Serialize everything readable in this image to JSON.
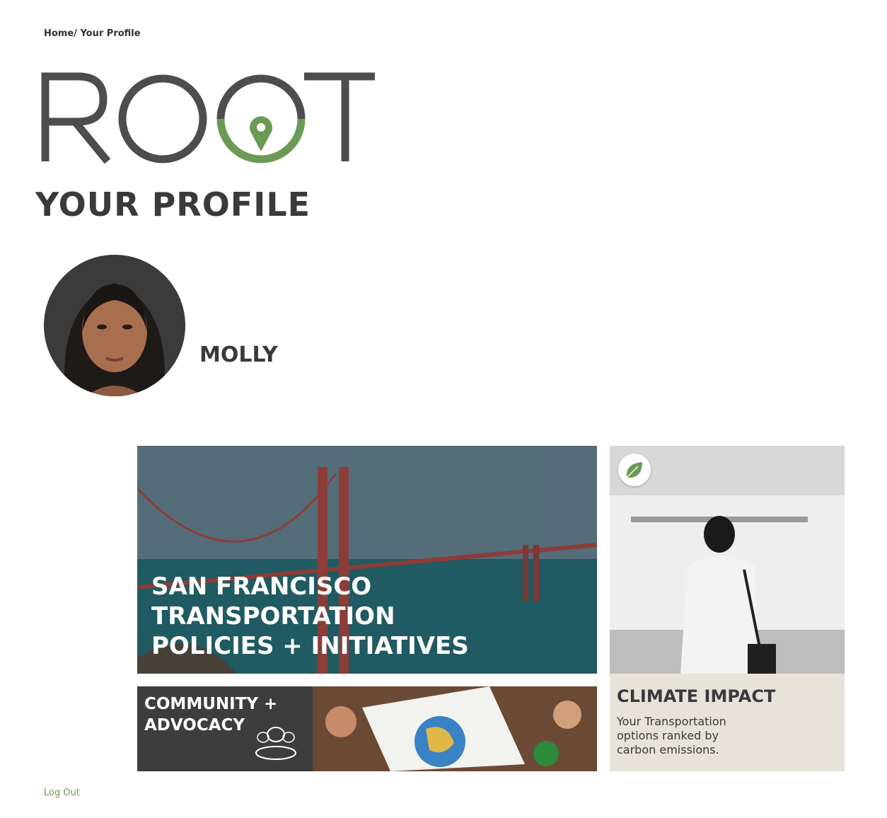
{
  "breadcrumb": {
    "text": "Home/ Your Profile"
  },
  "logo": {
    "text": "ROOT",
    "colors": {
      "gray": "#4d4d4d",
      "green": "#6b9a55"
    }
  },
  "page": {
    "title": "YOUR PROFILE"
  },
  "user": {
    "name": "MOLLY",
    "avatar_icon": "profile-photo"
  },
  "cards": {
    "sf": {
      "title_lines": [
        "SAN FRANCISCO",
        "TRANSPORTATION",
        "POLICIES + INITIATIVES"
      ]
    },
    "climate": {
      "title": "CLIMATE IMPACT",
      "description": "Your Transportation options ranked by carbon emissions.",
      "badge_icon": "leaf-icon"
    },
    "community": {
      "title_lines": [
        "COMMUNITY +",
        "ADVOCACY"
      ],
      "icon": "people-icon"
    }
  },
  "footer": {
    "logout_label": "Log Out"
  },
  "colors": {
    "text": "#3a3a3a",
    "accent_green": "#6b9a4f",
    "climate_bg": "#e8e3d9",
    "community_bg": "#3d3d3d"
  }
}
